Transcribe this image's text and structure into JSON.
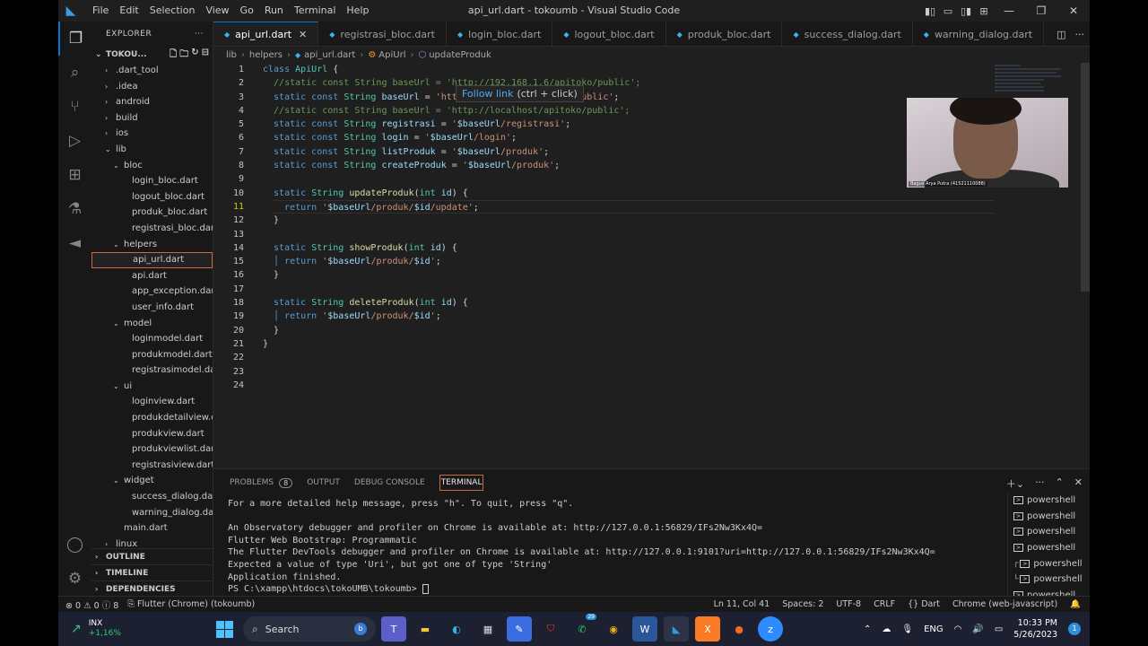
{
  "window": {
    "title": "api_url.dart - tokoumb - Visual Studio Code",
    "menu": [
      "File",
      "Edit",
      "Selection",
      "View",
      "Go",
      "Run",
      "Terminal",
      "Help"
    ]
  },
  "sidebar": {
    "header": "EXPLORER",
    "root": "TOKOU...",
    "items": [
      {
        "label": ".dart_tool",
        "indent": 1,
        "chevron": "›"
      },
      {
        "label": ".idea",
        "indent": 1,
        "chevron": "›"
      },
      {
        "label": "android",
        "indent": 1,
        "chevron": "›"
      },
      {
        "label": "build",
        "indent": 1,
        "chevron": "›"
      },
      {
        "label": "ios",
        "indent": 1,
        "chevron": "›"
      },
      {
        "label": "lib",
        "indent": 1,
        "chevron": "⌄"
      },
      {
        "label": "bloc",
        "indent": 2,
        "chevron": "⌄"
      },
      {
        "label": "login_bloc.dart",
        "indent": 3,
        "chevron": ""
      },
      {
        "label": "logout_bloc.dart",
        "indent": 3,
        "chevron": ""
      },
      {
        "label": "produk_bloc.dart",
        "indent": 3,
        "chevron": ""
      },
      {
        "label": "registrasi_bloc.dart",
        "indent": 3,
        "chevron": ""
      },
      {
        "label": "helpers",
        "indent": 2,
        "chevron": "⌄"
      },
      {
        "label": "api_url.dart",
        "indent": 3,
        "chevron": "",
        "selected": true
      },
      {
        "label": "api.dart",
        "indent": 3,
        "chevron": ""
      },
      {
        "label": "app_exception.dart",
        "indent": 3,
        "chevron": ""
      },
      {
        "label": "user_info.dart",
        "indent": 3,
        "chevron": ""
      },
      {
        "label": "model",
        "indent": 2,
        "chevron": "⌄"
      },
      {
        "label": "loginmodel.dart",
        "indent": 3,
        "chevron": ""
      },
      {
        "label": "produkmodel.dart",
        "indent": 3,
        "chevron": ""
      },
      {
        "label": "registrasimodel.dart",
        "indent": 3,
        "chevron": ""
      },
      {
        "label": "ui",
        "indent": 2,
        "chevron": "⌄"
      },
      {
        "label": "loginview.dart",
        "indent": 3,
        "chevron": ""
      },
      {
        "label": "produkdetailview.d...",
        "indent": 3,
        "chevron": ""
      },
      {
        "label": "produkview.dart",
        "indent": 3,
        "chevron": ""
      },
      {
        "label": "produkviewlist.dart",
        "indent": 3,
        "chevron": ""
      },
      {
        "label": "registrasiview.dart",
        "indent": 3,
        "chevron": ""
      },
      {
        "label": "widget",
        "indent": 2,
        "chevron": "⌄"
      },
      {
        "label": "success_dialog.dart",
        "indent": 3,
        "chevron": ""
      },
      {
        "label": "warning_dialog.dart",
        "indent": 3,
        "chevron": ""
      },
      {
        "label": "main.dart",
        "indent": 2,
        "chevron": ""
      },
      {
        "label": "linux",
        "indent": 1,
        "chevron": "›"
      }
    ],
    "sections": [
      "OUTLINE",
      "TIMELINE",
      "DEPENDENCIES"
    ]
  },
  "tabs": [
    {
      "label": "api_url.dart",
      "active": true
    },
    {
      "label": "registrasi_bloc.dart"
    },
    {
      "label": "login_bloc.dart"
    },
    {
      "label": "logout_bloc.dart"
    },
    {
      "label": "produk_bloc.dart"
    },
    {
      "label": "success_dialog.dart"
    },
    {
      "label": "warning_dialog.dart"
    }
  ],
  "breadcrumb": [
    "lib",
    "helpers",
    "api_url.dart",
    "ApiUrl",
    "updateProduk"
  ],
  "editor": {
    "current_line": 11,
    "hover": {
      "link": "Follow link",
      "hint": "(ctrl + click)"
    },
    "lines": [
      [
        [
          "kw",
          "class "
        ],
        [
          "ty",
          "ApiUrl"
        ],
        [
          "pl",
          " {"
        ]
      ],
      [
        [
          "cm",
          "  //static const String baseUrl = 'http://192.168.1.6/apitoko/public';"
        ]
      ],
      [
        [
          "kw",
          "  static const "
        ],
        [
          "ty",
          "String "
        ],
        [
          "vr",
          "baseUrl"
        ],
        [
          "pl",
          " = "
        ],
        [
          "st",
          "'http://localhost/apitoko/public'"
        ],
        [
          "pl",
          ";"
        ]
      ],
      [
        [
          "cm",
          "  //static const String baseUrl = 'http://localhost/apitoko/public';"
        ]
      ],
      [
        [
          "kw",
          "  static const "
        ],
        [
          "ty",
          "String "
        ],
        [
          "vr",
          "registrasi"
        ],
        [
          "pl",
          " = "
        ],
        [
          "st",
          "'"
        ],
        [
          "vr",
          "$baseUrl"
        ],
        [
          "st",
          "/registrasi'"
        ],
        [
          "pl",
          ";"
        ]
      ],
      [
        [
          "kw",
          "  static const "
        ],
        [
          "ty",
          "String "
        ],
        [
          "vr",
          "login"
        ],
        [
          "pl",
          " = "
        ],
        [
          "st",
          "'"
        ],
        [
          "vr",
          "$baseUrl"
        ],
        [
          "st",
          "/login'"
        ],
        [
          "pl",
          ";"
        ]
      ],
      [
        [
          "kw",
          "  static const "
        ],
        [
          "ty",
          "String "
        ],
        [
          "vr",
          "listProduk"
        ],
        [
          "pl",
          " = "
        ],
        [
          "st",
          "'"
        ],
        [
          "vr",
          "$baseUrl"
        ],
        [
          "st",
          "/produk'"
        ],
        [
          "pl",
          ";"
        ]
      ],
      [
        [
          "kw",
          "  static const "
        ],
        [
          "ty",
          "String "
        ],
        [
          "vr",
          "createProduk"
        ],
        [
          "pl",
          " = "
        ],
        [
          "st",
          "'"
        ],
        [
          "vr",
          "$baseUrl"
        ],
        [
          "st",
          "/produk'"
        ],
        [
          "pl",
          ";"
        ]
      ],
      [
        [
          "pl",
          ""
        ]
      ],
      [
        [
          "kw",
          "  static "
        ],
        [
          "ty",
          "String "
        ],
        [
          "fn",
          "updateProduk"
        ],
        [
          "pl",
          "("
        ],
        [
          "ty",
          "int "
        ],
        [
          "vr",
          "id"
        ],
        [
          "pl",
          ") {"
        ]
      ],
      [
        [
          "kw",
          "  return "
        ],
        [
          "st",
          "'"
        ],
        [
          "vr",
          "$baseUrl"
        ],
        [
          "st",
          "/produk/"
        ],
        [
          "vr",
          "$id"
        ],
        [
          "st",
          "/update'"
        ],
        [
          "pl",
          ";"
        ]
      ],
      [
        [
          "pl",
          "  }"
        ]
      ],
      [
        [
          "pl",
          ""
        ]
      ],
      [
        [
          "kw",
          "  static "
        ],
        [
          "ty",
          "String "
        ],
        [
          "fn",
          "showProduk"
        ],
        [
          "pl",
          "("
        ],
        [
          "ty",
          "int "
        ],
        [
          "vr",
          "id"
        ],
        [
          "pl",
          ") {"
        ]
      ],
      [
        [
          "kw",
          "  │ return "
        ],
        [
          "st",
          "'"
        ],
        [
          "vr",
          "$baseUrl"
        ],
        [
          "st",
          "/produk/"
        ],
        [
          "vr",
          "$id"
        ],
        [
          "st",
          "'"
        ],
        [
          "pl",
          ";"
        ]
      ],
      [
        [
          "pl",
          "  }"
        ]
      ],
      [
        [
          "pl",
          ""
        ]
      ],
      [
        [
          "kw",
          "  static "
        ],
        [
          "ty",
          "String "
        ],
        [
          "fn",
          "deleteProduk"
        ],
        [
          "pl",
          "("
        ],
        [
          "ty",
          "int "
        ],
        [
          "vr",
          "id"
        ],
        [
          "pl",
          ") {"
        ]
      ],
      [
        [
          "kw",
          "  │ return "
        ],
        [
          "st",
          "'"
        ],
        [
          "vr",
          "$baseUrl"
        ],
        [
          "st",
          "/produk/"
        ],
        [
          "vr",
          "$id"
        ],
        [
          "st",
          "'"
        ],
        [
          "pl",
          ";"
        ]
      ],
      [
        [
          "pl",
          "  }"
        ]
      ],
      [
        [
          "pl",
          "}"
        ]
      ],
      [
        [
          "pl",
          ""
        ]
      ],
      [
        [
          "pl",
          ""
        ]
      ],
      [
        [
          "pl",
          ""
        ]
      ]
    ]
  },
  "webcam": {
    "name": "Bagus Arya Putra (41521110088)"
  },
  "panel": {
    "tabs": [
      {
        "label": "PROBLEMS",
        "badge": "8"
      },
      {
        "label": "OUTPUT"
      },
      {
        "label": "DEBUG CONSOLE"
      },
      {
        "label": "TERMINAL",
        "active": true
      }
    ],
    "terminal_lines": [
      "For a more detailed help message, press \"h\". To quit, press \"q\".",
      "",
      "An Observatory debugger and profiler on Chrome is available at: http://127.0.0.1:56829/IFs2Nw3Kx4Q=",
      "Flutter Web Bootstrap: Programmatic",
      "The Flutter DevTools debugger and profiler on Chrome is available at: http://127.0.0.1:9101?uri=http://127.0.0.1:56829/IFs2Nw3Kx4Q=",
      "Expected a value of type 'Uri', but got one of type 'String'",
      "Application finished.",
      "PS C:\\xampp\\htdocs\\tokoUMB\\tokoumb> "
    ],
    "terminals": [
      {
        "label": "powershell",
        "tree": ""
      },
      {
        "label": "powershell",
        "tree": ""
      },
      {
        "label": "powershell",
        "tree": ""
      },
      {
        "label": "powershell",
        "tree": ""
      },
      {
        "label": "powershell",
        "tree": "┌"
      },
      {
        "label": "powershell",
        "tree": "└"
      },
      {
        "label": "powershell",
        "tree": ""
      }
    ]
  },
  "statusbar": {
    "errors": "0",
    "warnings": "0",
    "infos": "8",
    "device": "Flutter (Chrome) (tokoumb)",
    "position": "Ln 11, Col 41",
    "spaces": "Spaces: 2",
    "encoding": "UTF-8",
    "eol": "CRLF",
    "language": "Dart",
    "target": "Chrome (web-javascript)"
  },
  "taskbar": {
    "weather_name": "INX",
    "weather_value": "+1,16%",
    "search": "Search",
    "whatsapp_badge": "29",
    "language": "ENG",
    "time": "10:33 PM",
    "date": "5/26/2023",
    "notifications": "1"
  }
}
